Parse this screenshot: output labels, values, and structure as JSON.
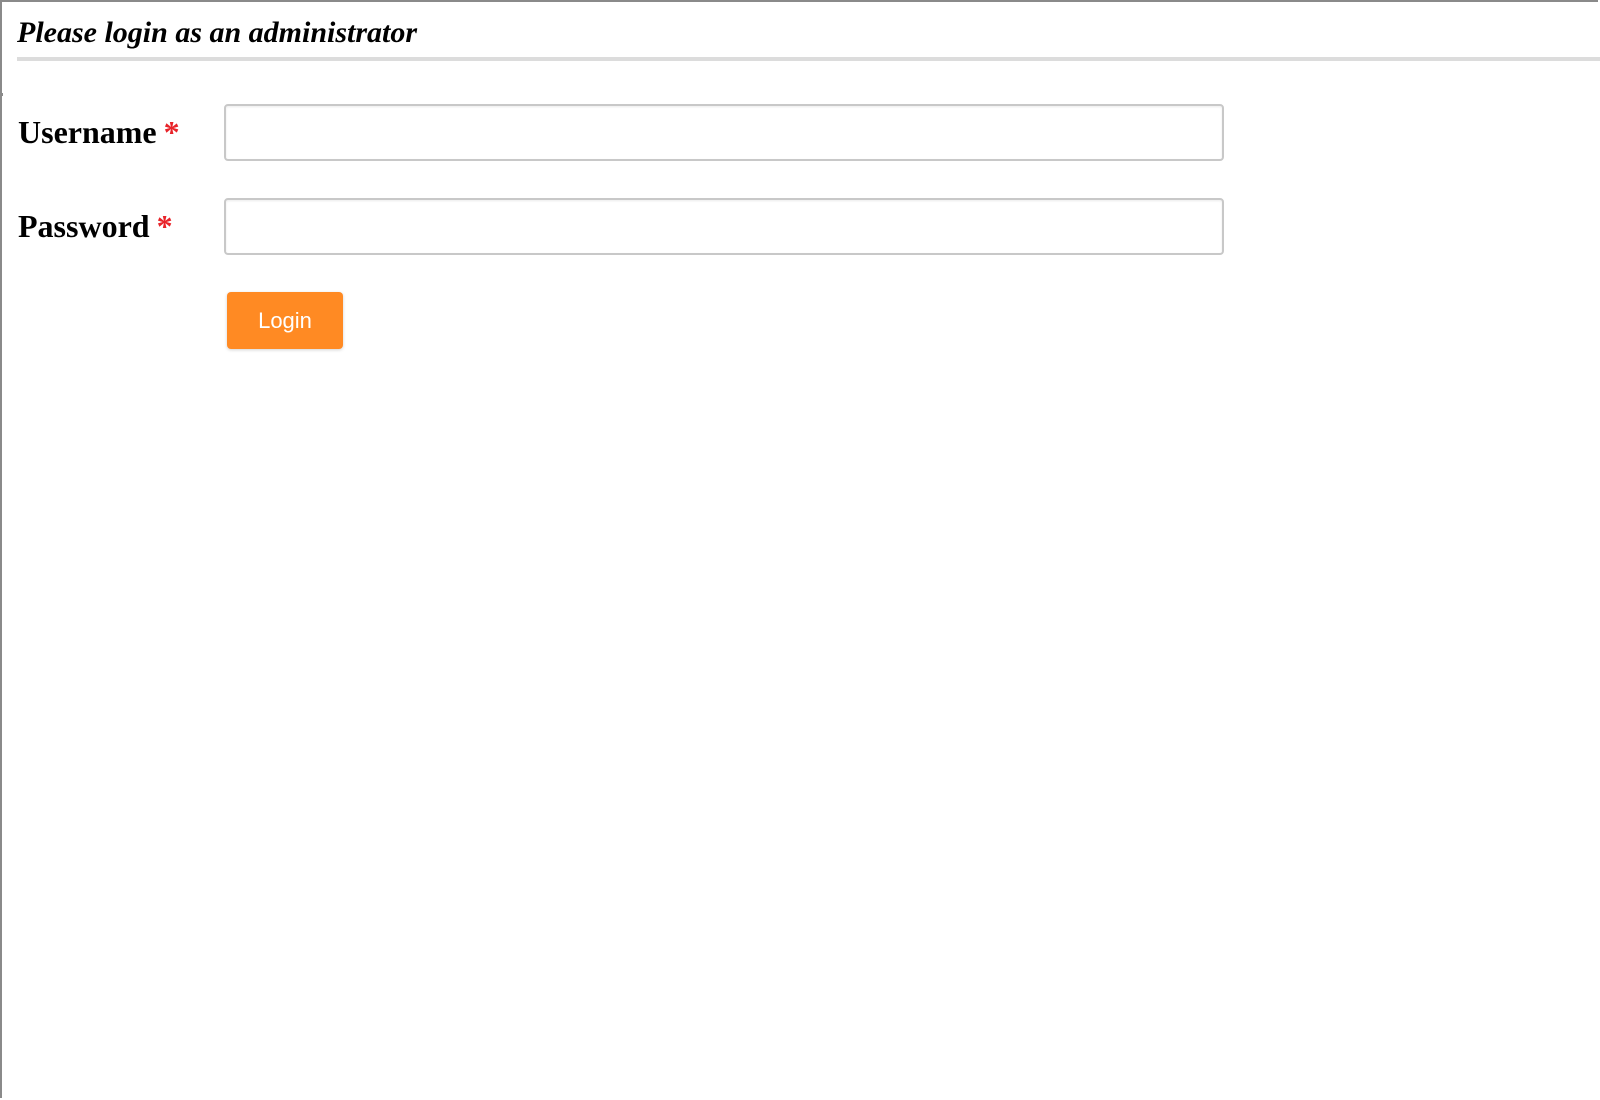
{
  "page": {
    "title": "Please login as an administrator"
  },
  "form": {
    "username": {
      "label": "Username",
      "required_mark": "*",
      "value": "",
      "placeholder": ""
    },
    "password": {
      "label": "Password",
      "required_mark": "*",
      "value": "",
      "placeholder": ""
    },
    "login_button_label": "Login"
  },
  "colors": {
    "accent": "#ff8a23",
    "required": "#e8242a",
    "rule": "#dcdcdc",
    "input_border": "#c8c8c8"
  }
}
